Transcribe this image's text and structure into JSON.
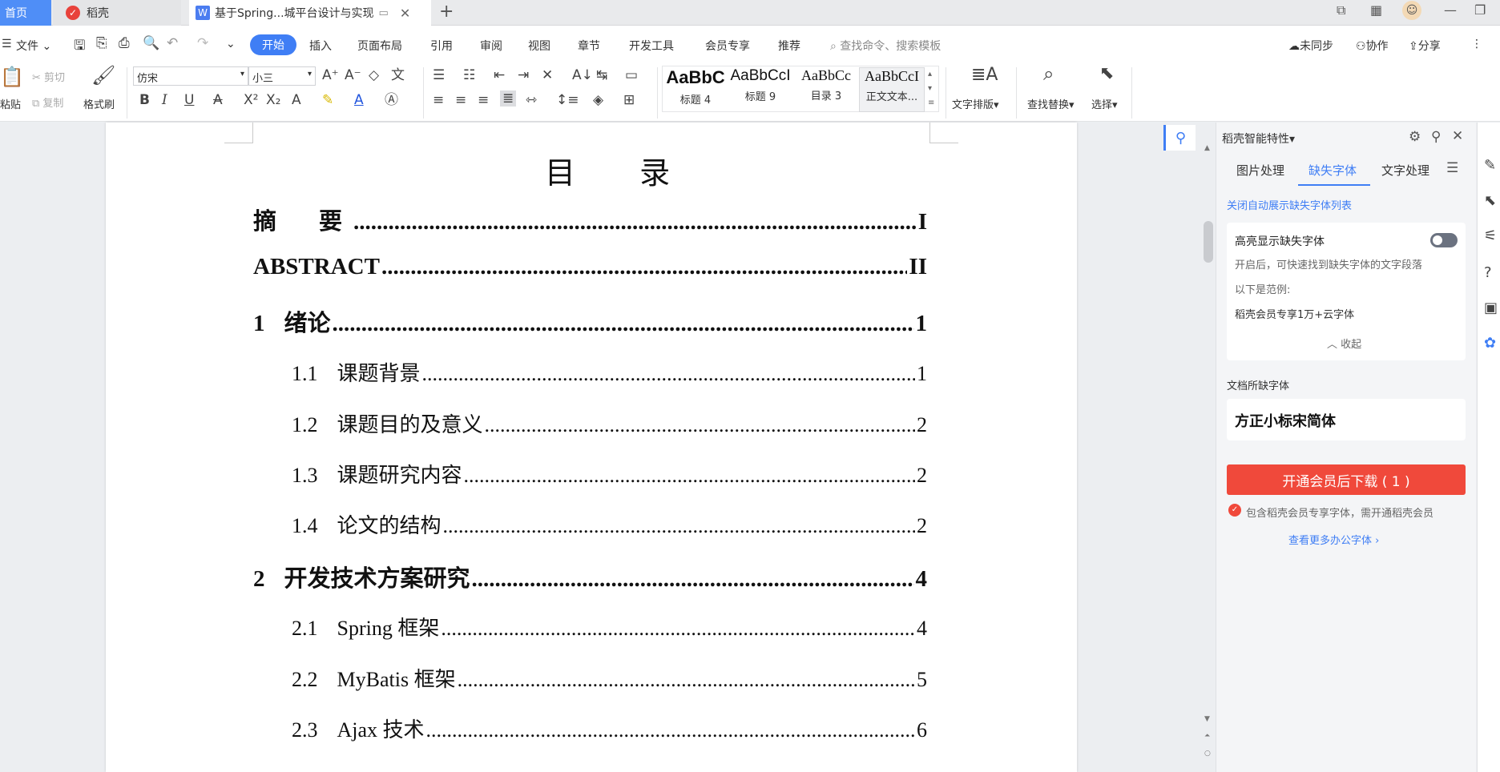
{
  "tabs": {
    "home": "首页",
    "daoke": "稻壳",
    "doc": "基于Spring...城平台设计与实现"
  },
  "menu": {
    "file": "文件",
    "items": [
      "开始",
      "插入",
      "页面布局",
      "引用",
      "审阅",
      "视图",
      "章节",
      "开发工具",
      "会员专享",
      "推荐"
    ],
    "search_placeholder": "查找命令、搜索模板",
    "sync": "未同步",
    "collab": "协作",
    "share": "分享"
  },
  "ribbon": {
    "paste": "粘贴",
    "cut": "剪切",
    "copy": "复制",
    "format_painter": "格式刷",
    "font_family": "仿宋",
    "font_size": "小三",
    "styles": [
      {
        "sample": "AaBbC",
        "name": "标题 4"
      },
      {
        "sample": "AaBbCcI",
        "name": "标题 9"
      },
      {
        "sample": "AaBbCc",
        "name": "目录 3"
      },
      {
        "sample": "AaBbCcI",
        "name": "正文文本..."
      }
    ],
    "text_layout": "文字排版",
    "find_replace": "查找替换",
    "select": "选择"
  },
  "document": {
    "toc_title": "目 录",
    "entries": [
      {
        "level": 1,
        "num": "",
        "title": "摘　要",
        "page": "I"
      },
      {
        "level": 1,
        "num": "",
        "title": "ABSTRACT",
        "page": "II"
      },
      {
        "level": 1,
        "num": "1",
        "title": "绪论",
        "page": "1"
      },
      {
        "level": 2,
        "num": "1.1",
        "title": "课题背景",
        "page": "1"
      },
      {
        "level": 2,
        "num": "1.2",
        "title": "课题目的及意义",
        "page": "2"
      },
      {
        "level": 2,
        "num": "1.3",
        "title": "课题研究内容",
        "page": "2"
      },
      {
        "level": 2,
        "num": "1.4",
        "title": "论文的结构",
        "page": "2"
      },
      {
        "level": 1,
        "num": "2",
        "title": "开发技术方案研究",
        "page": "4"
      },
      {
        "level": 2,
        "num": "2.1",
        "title": "Spring 框架",
        "page": "4"
      },
      {
        "level": 2,
        "num": "2.2",
        "title": "MyBatis 框架",
        "page": "5"
      },
      {
        "level": 2,
        "num": "2.3",
        "title": "Ajax 技术",
        "page": "6"
      }
    ]
  },
  "panel": {
    "title": "稻壳智能特性",
    "tabs": [
      "图片处理",
      "缺失字体",
      "文字处理"
    ],
    "active_tab": "缺失字体",
    "close_auto_link": "关闭自动展示缺失字体列表",
    "highlight_label": "高亮显示缺失字体",
    "highlight_desc": "开启后，可快速找到缺失字体的文字段落",
    "example_label": "以下是范例:",
    "example_text": "稻壳会员专享1万+云字体",
    "collapse": "收起",
    "missing_header": "文档所缺字体",
    "missing_font": "方正小标宋简体",
    "download_btn": "开通会员后下载 ( 1 )",
    "notice": "包含稻壳会员专享字体，需开通稻壳会员",
    "more_link": "查看更多办公字体"
  },
  "colors": {
    "accent": "#3f7ef5",
    "download": "#f0493b"
  }
}
